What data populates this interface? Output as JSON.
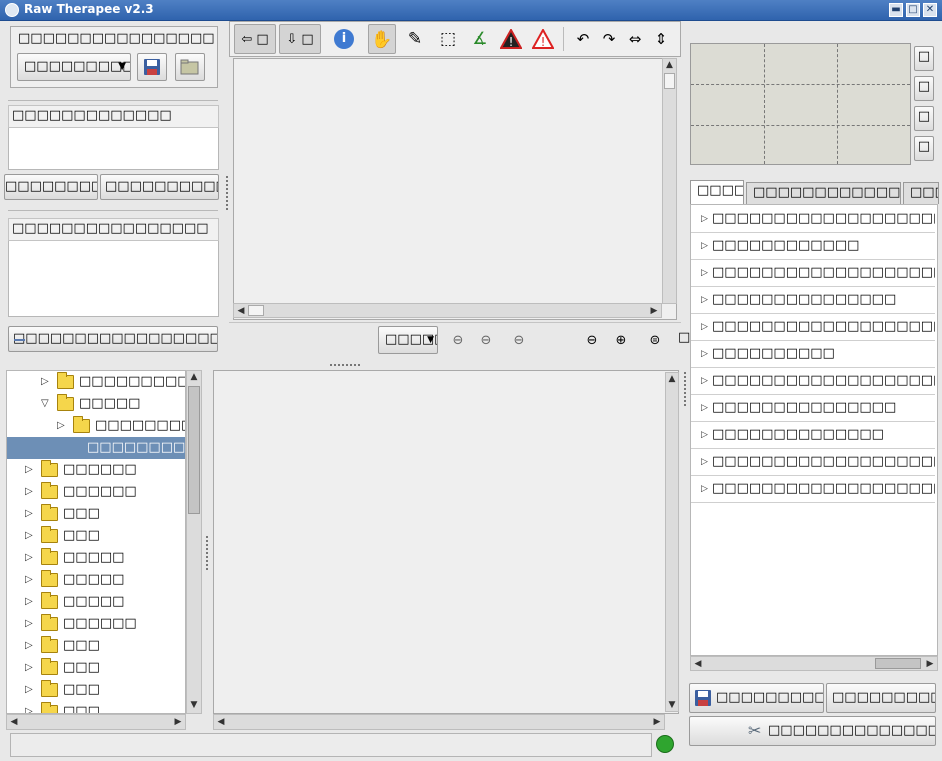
{
  "window": {
    "title": "Raw Therapee v2.3",
    "min_label": "▬",
    "max_label": "□",
    "close_label": "✕"
  },
  "left_panel": {
    "profile_header": "□□□□□□□□□□□□□□□□□□□□□□□□□",
    "profile_select_value": "□□□□□□□□□",
    "section1_header": "□□□□□□□□□□□□□",
    "btn_a_label": "□□□□□□□□□□□",
    "btn_b_label": "□□□□□□□□□□□□□□",
    "section2_header": "□□□□□□□□□□□□□□□□",
    "bottom_bar_label": "□□□□□□□□□□□□□□□□□□□□□□□□□□□□□□□□□□□□□□□□□□□□□□□□□□"
  },
  "toolbar": {
    "prev_label": "⇦ □",
    "next_label": "⇩ □",
    "info_icon": "ⓘ",
    "hand_icon": "✋",
    "picker_icon": "✎",
    "crop_icon": "⬚",
    "straighten_icon": "∡",
    "warn_dark_icon": "!",
    "warn_light_icon": "!",
    "rot_ccw_icon": "↶",
    "rot_cw_icon": "↷",
    "flip_h_icon": "⇔",
    "flip_v_icon": "⇕"
  },
  "zoom_bar": {
    "select_value": "□□□□□□",
    "zoom_out_icon": "⊖",
    "zoom_in_icon": "⊕",
    "zoom_fit_icon": "⊜",
    "more_label": "□"
  },
  "tree": [
    {
      "label": "□□□□□□□□□□",
      "indent": 2,
      "expander": "▷",
      "open": false,
      "selected": false,
      "folder": true
    },
    {
      "label": "□□□□□",
      "indent": 2,
      "expander": "▽",
      "open": true,
      "selected": false,
      "folder": true
    },
    {
      "label": "□□□□□□□□□",
      "indent": 3,
      "expander": "▷",
      "open": false,
      "selected": false,
      "folder": true
    },
    {
      "label": "□□□□□□□□□",
      "indent": 4,
      "expander": "",
      "open": false,
      "selected": true,
      "folder": false
    },
    {
      "label": "□□□□□□",
      "indent": 1,
      "expander": "▷",
      "open": false,
      "selected": false,
      "folder": true
    },
    {
      "label": "□□□□□□",
      "indent": 1,
      "expander": "▷",
      "open": false,
      "selected": false,
      "folder": true
    },
    {
      "label": "□□□",
      "indent": 1,
      "expander": "▷",
      "open": false,
      "selected": false,
      "folder": true
    },
    {
      "label": "□□□",
      "indent": 1,
      "expander": "▷",
      "open": false,
      "selected": false,
      "folder": true
    },
    {
      "label": "□□□□□",
      "indent": 1,
      "expander": "▷",
      "open": false,
      "selected": false,
      "folder": true
    },
    {
      "label": "□□□□□",
      "indent": 1,
      "expander": "▷",
      "open": false,
      "selected": false,
      "folder": true
    },
    {
      "label": "□□□□□",
      "indent": 1,
      "expander": "▷",
      "open": false,
      "selected": false,
      "folder": true
    },
    {
      "label": "□□□□□□",
      "indent": 1,
      "expander": "▷",
      "open": false,
      "selected": false,
      "folder": true
    },
    {
      "label": "□□□",
      "indent": 1,
      "expander": "▷",
      "open": false,
      "selected": false,
      "folder": true
    },
    {
      "label": "□□□",
      "indent": 1,
      "expander": "▷",
      "open": false,
      "selected": false,
      "folder": true
    },
    {
      "label": "□□□",
      "indent": 1,
      "expander": "▷",
      "open": false,
      "selected": false,
      "folder": true
    },
    {
      "label": "□□□",
      "indent": 1,
      "expander": "▷",
      "open": false,
      "selected": false,
      "folder": true
    }
  ],
  "right_panel": {
    "side_btns": [
      "□",
      "□",
      "□",
      "□"
    ],
    "tabs": [
      "□□□□",
      "□□□□□□□□□□□□□□□□□□□□",
      "□□□□"
    ],
    "tools": [
      "□□□□□□□□□□□□□□□□□□□",
      "□□□□□□□□□□□□",
      "□□□□□□□□□□□□□□□□□□□□□□□□□□□□□□□□□□",
      "□□□□□□□□□□□□□□□",
      "□□□□□□□□□□□□□□□□□□□□□□□□□□□□□□□□",
      "□□□□□□□□□□",
      "□□□□□□□□□□□□□□□□□□□□",
      "□□□□□□□□□□□□□□□",
      "□□□□□□□□□□□□□□",
      "□□□□□□□□□□□□□□□□□□□□□□□□□□□□□□□□□□□",
      "□□□□□□□□□□□□□□□□□□□□□□□□□□"
    ],
    "save_label": "□□□□□□□□□□□□□",
    "queue_label": "□□□□□□□□□□□□□",
    "process_label": "□□□□□□□□□□□□□□□"
  },
  "status": {
    "indicator_color": "#2fa52f"
  }
}
